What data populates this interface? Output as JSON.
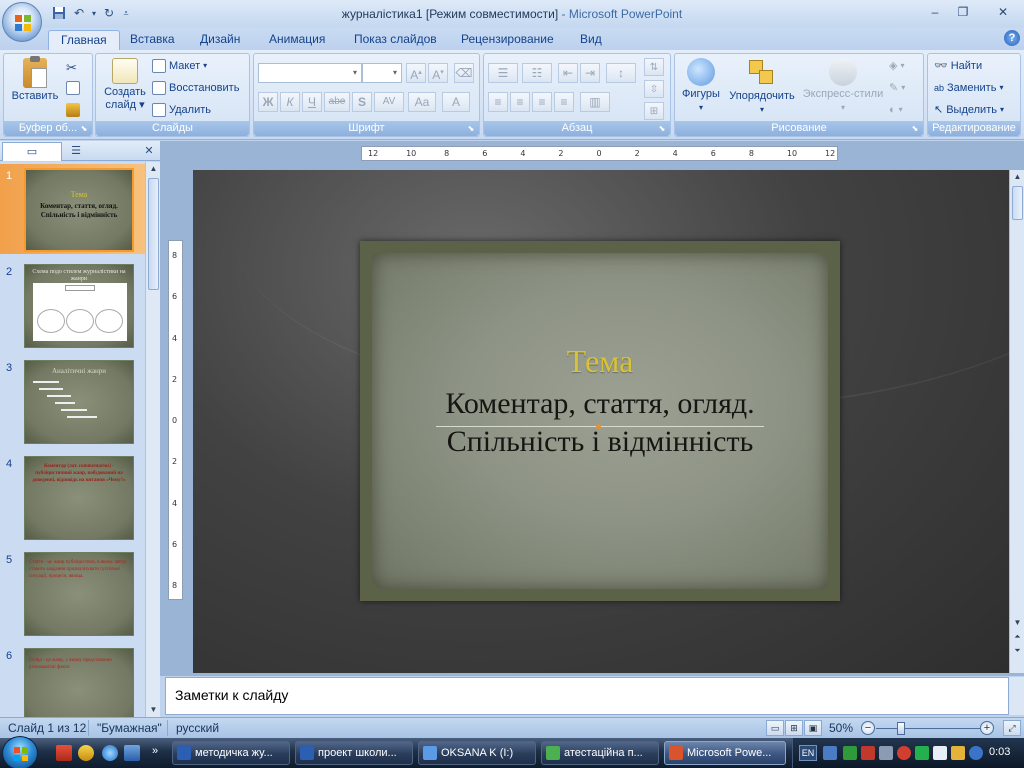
{
  "window": {
    "title": "журналістика1 [Режим совместимости]",
    "app_suffix": " - Microsoft PowerPoint",
    "minimize": "–",
    "restore": "❐",
    "close": "✕"
  },
  "ribbon_tabs": [
    "Главная",
    "Вставка",
    "Дизайн",
    "Анимация",
    "Показ слайдов",
    "Рецензирование",
    "Вид"
  ],
  "active_tab": "Главная",
  "groups": {
    "clipboard": {
      "label": "Буфер об...",
      "paste": "Вставить"
    },
    "slides": {
      "label": "Слайды",
      "new_slide_line1": "Создать",
      "new_slide_line2": "слайд",
      "layout": "Макет",
      "reset": "Восстановить",
      "delete": "Удалить"
    },
    "font": {
      "label": "Шрифт",
      "bold": "Ж",
      "italic": "К",
      "underline": "Ч",
      "strike": "abe",
      "shadow": "S",
      "spacing": "AV",
      "case": "Aa",
      "color": "A"
    },
    "paragraph": {
      "label": "Абзац"
    },
    "drawing": {
      "label": "Рисование",
      "shapes": "Фигуры",
      "arrange": "Упорядочить",
      "quick_styles": "Экспресс-стили"
    },
    "editing": {
      "label": "Редактирование",
      "find": "Найти",
      "replace": "Заменить",
      "select": "Выделить"
    }
  },
  "ruler": {
    "h_ticks": [
      "12",
      "10",
      "8",
      "6",
      "4",
      "2",
      "0",
      "2",
      "4",
      "6",
      "8",
      "10",
      "12"
    ],
    "v_ticks": [
      "8",
      "6",
      "4",
      "2",
      "0",
      "2",
      "4",
      "6",
      "8"
    ]
  },
  "thumbnails": [
    {
      "num": "1",
      "line1": "Тема",
      "line2": "Коментар, стаття, огляд.",
      "line3": "Спільність і відмінність",
      "selected": true
    },
    {
      "num": "2",
      "line1": "Схема подо стилем журналістики на жанри",
      "selected": false
    },
    {
      "num": "3",
      "line1": "Аналітичні жанри",
      "selected": false
    },
    {
      "num": "4",
      "line1": "Коментар (лат. commentarius) - публіцистичний жанр, побудований на доведенні, відповідь на питання «Чому?»",
      "selected": false
    },
    {
      "num": "5",
      "line1": "Стаття - це жанр публіцистики, в якому автор ставить завдання проаналізувати суспільні ситуації, процеси, явища.",
      "selected": false
    },
    {
      "num": "6",
      "line1": "Огляд - це жанр, у якому представлено різноманітні факти",
      "selected": false
    }
  ],
  "slide": {
    "title": "Тема",
    "subtitle_line1": "Коментар, стаття, огляд.",
    "subtitle_line2": "Спільність і відмінність"
  },
  "notes_placeholder": "Заметки к слайду",
  "status": {
    "slide_info": "Слайд 1 из 12",
    "theme": "\"Бумажная\"",
    "language": "русский",
    "zoom": "50%"
  },
  "taskbar": {
    "tasks": [
      {
        "label": "методичка жу...",
        "active": false
      },
      {
        "label": "проект школи...",
        "active": false
      },
      {
        "label": "OKSANA K (I:)",
        "active": false
      },
      {
        "label": "атестаційна п...",
        "active": false
      },
      {
        "label": "Microsoft Powe...",
        "active": true
      }
    ],
    "lang": "EN",
    "clock": "0:03"
  },
  "colors": {
    "ribbon_bg": "#d6e4f6",
    "slide_title": "#d8c23a",
    "slide_text": "#151512",
    "selected_thumb": "#f59a2e"
  }
}
